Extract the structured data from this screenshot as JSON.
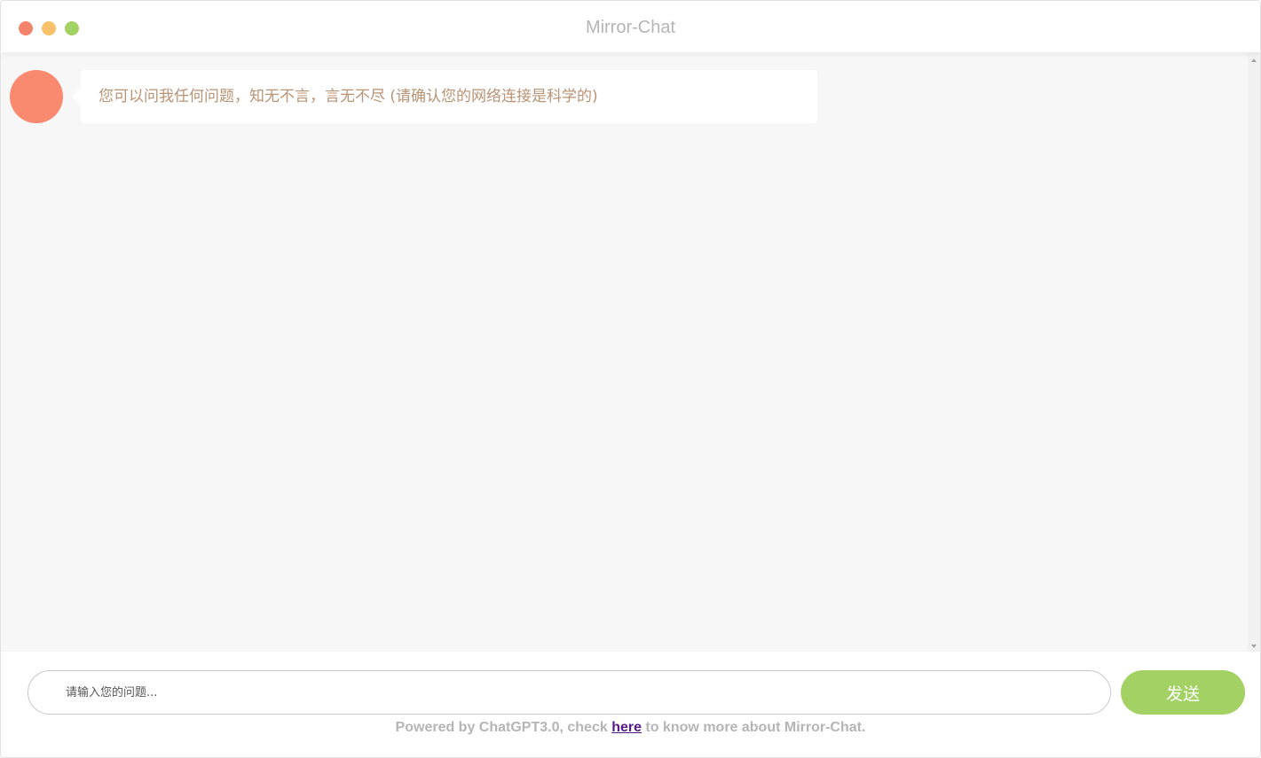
{
  "window": {
    "title": "Mirror-Chat",
    "controls": {
      "close_color": "#f3846b",
      "minimize_color": "#f8c168",
      "maximize_color": "#a3d164"
    }
  },
  "chat": {
    "messages": [
      {
        "role": "bot",
        "avatar_color": "#f98a70",
        "text": "您可以问我任何问题，知无不言，言无不尽 (请确认您的网络连接是科学的)",
        "text_color": "#b99374"
      }
    ]
  },
  "composer": {
    "placeholder": "请输入您的问题...",
    "value": "",
    "send_label": "发送",
    "send_color": "#a3d164"
  },
  "footer": {
    "prefix": "Powered by ChatGPT3.0, check ",
    "link_text": "here",
    "link_color": "#551a8b",
    "suffix": " to know more about Mirror-Chat."
  }
}
